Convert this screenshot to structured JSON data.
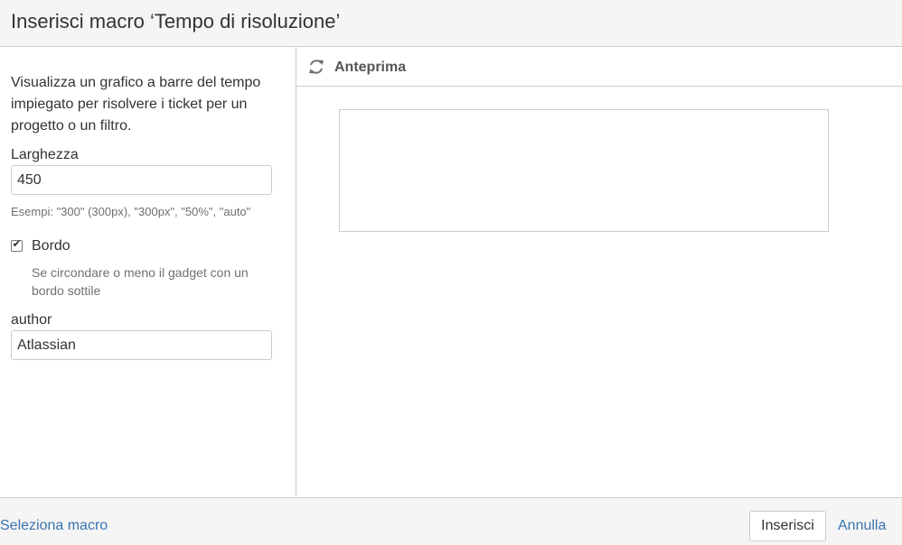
{
  "dialog": {
    "title": "Inserisci macro ‘Tempo di risoluzione’"
  },
  "params": {
    "description": "Visualizza un grafico a barre del tempo impiegato per risolvere i ticket per un progetto o un filtro.",
    "width": {
      "label": "Larghezza",
      "value": "450",
      "hint": "Esempi: \"300\" (300px), \"300px\", \"50%\", \"auto\""
    },
    "border": {
      "label": "Bordo",
      "checked": true,
      "description": "Se circondare o meno il gadget con un bordo sottile"
    },
    "author": {
      "label": "author",
      "value": "Atlassian"
    }
  },
  "preview": {
    "label": "Anteprima",
    "icon": "refresh-icon"
  },
  "footer": {
    "select_macro": "Seleziona macro",
    "insert": "Inserisci",
    "cancel": "Annulla"
  },
  "colors": {
    "link": "#3b73af",
    "panel_bg": "#f5f5f5",
    "border": "#cccccc"
  }
}
